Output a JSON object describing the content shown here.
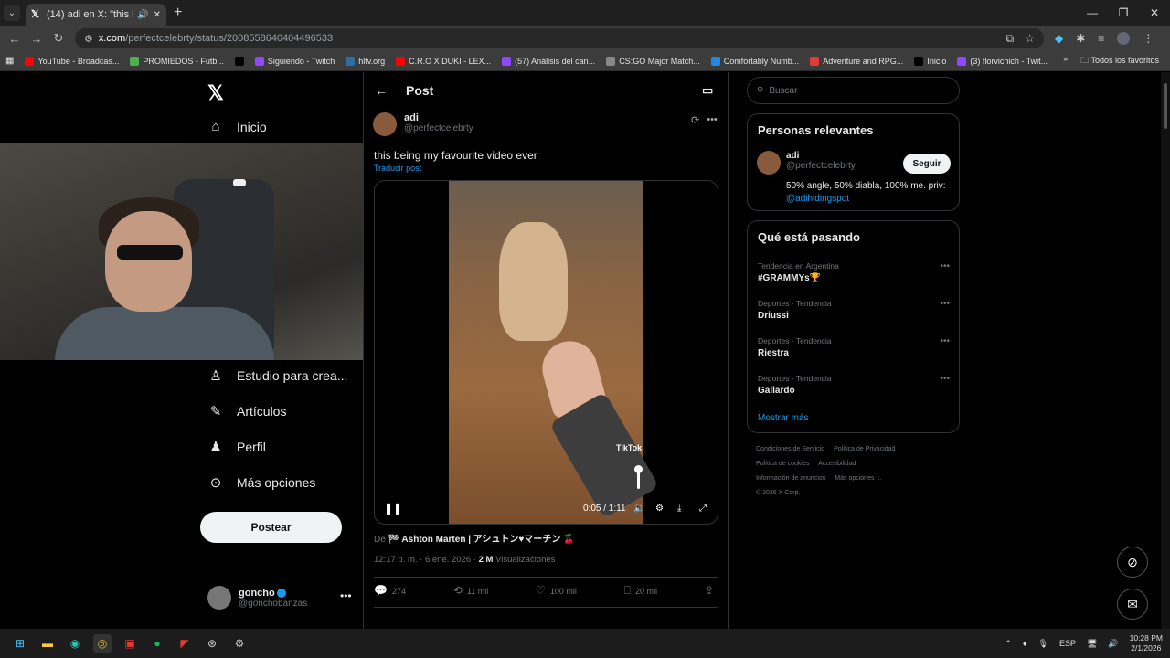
{
  "browser": {
    "tab_title": "(14) adi en X: \"this being m",
    "url_domain": "x.com",
    "url_path": "/perfectcelebrty/status/2008558640404496533",
    "bookmarks": [
      {
        "label": "YouTube - Broadcas...",
        "color": "#ff0000"
      },
      {
        "label": "PROMIEDOS - Futb...",
        "color": "#4caf50"
      },
      {
        "label": "",
        "color": "#000000"
      },
      {
        "label": "Siguiendo - Twitch",
        "color": "#9146ff"
      },
      {
        "label": "hltv.org",
        "color": "#2b6ea6"
      },
      {
        "label": "C.R.O X DUKI - LEX...",
        "color": "#ff0000"
      },
      {
        "label": "(57) Análisis del can...",
        "color": "#9146ff"
      },
      {
        "label": "CS:GO Major Match...",
        "color": "#888888"
      },
      {
        "label": "Comfortably Numb...",
        "color": "#1e88e5"
      },
      {
        "label": "Adventure and RPG...",
        "color": "#e53935"
      },
      {
        "label": "Inicio",
        "color": "#000000"
      },
      {
        "label": "(3) florvichich - Twit...",
        "color": "#9146ff"
      }
    ],
    "bookmarks_folder": "Todos los favoritos"
  },
  "nav": {
    "home": "Inicio",
    "studio": "Estudio para crea...",
    "articles": "Artículos",
    "profile": "Perfil",
    "more": "Más opciones",
    "post_button": "Postear",
    "me_name": "goncho",
    "me_handle": "@gonchobanzas"
  },
  "post": {
    "header": "Post",
    "author_name": "adi",
    "author_handle": "@perfectcelebrty",
    "text": "this being my favourite video ever",
    "translate": "Traducir post",
    "video_time": "0:05 / 1:11",
    "watermark": "TikTok",
    "source_prefix": "De",
    "source_name": "🏁 Ashton Marten | アシュトン♥マーチン 🍒",
    "timestamp": "12:17 p. m. · 6 ene. 2026 ·",
    "views_count": "2 M",
    "views_label": "Visualizaciones",
    "replies": "274",
    "reposts": "11 mil",
    "likes": "100 mil",
    "bookmarks": "20 mil"
  },
  "sidebar": {
    "search_placeholder": "Buscar",
    "relevant_title": "Personas relevantes",
    "rel_name": "adi",
    "rel_handle": "@perfectcelebrty",
    "follow": "Seguir",
    "bio": "50% angle, 50% diabla, 100% me. priv:",
    "bio_link": "@adihidingspot",
    "trends_title": "Qué está pasando",
    "trends": [
      {
        "context": "Tendencia en Argentina",
        "name": "#GRAMMYs🏆"
      },
      {
        "context": "Deportes · Tendencia",
        "name": "Driussi"
      },
      {
        "context": "Deportes · Tendencia",
        "name": "Riestra"
      },
      {
        "context": "Deportes · Tendencia",
        "name": "Gallardo"
      }
    ],
    "show_more": "Mostrar más",
    "footer": [
      "Condiciones de Servicio",
      "Política de Privacidad",
      "Política de cookies",
      "Accesibilidad",
      "Información de anuncios",
      "Más opciones ...",
      "© 2026 X Corp."
    ]
  },
  "taskbar": {
    "lang": "ESP",
    "time": "10:28 PM",
    "date": "2/1/2026"
  }
}
